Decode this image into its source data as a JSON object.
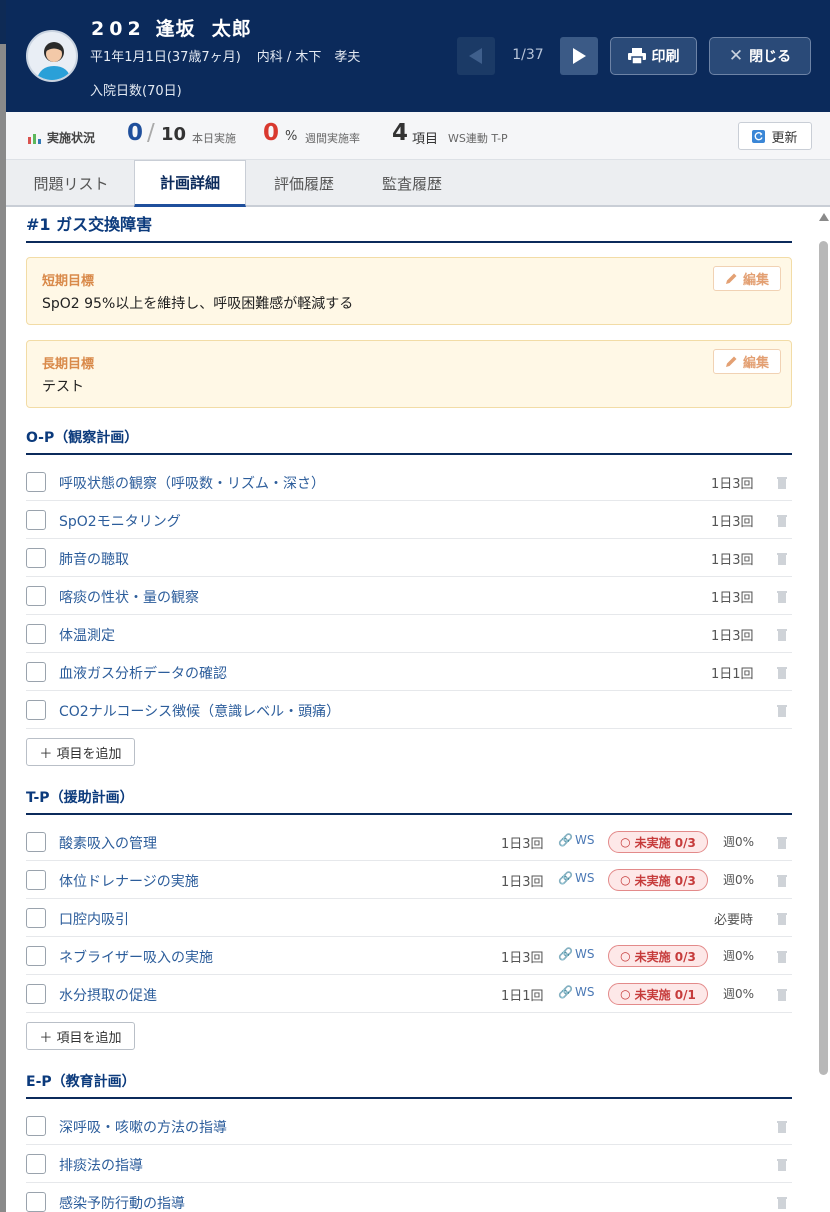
{
  "header": {
    "room": "202",
    "last_name": "逢坂",
    "first_name": "太郎",
    "birth": "平1年1月1日(37歳7ヶ月)",
    "dept_doctor": "内科 / 木下　孝夫",
    "admission_days": "入院日数(70日)",
    "pager": "1/37",
    "print_label": "印刷",
    "close_label": "閉じる"
  },
  "status": {
    "label": "実施状況",
    "done": "0",
    "slash": "/",
    "total": "10",
    "today_label": "本日実施",
    "rate": "0",
    "rate_unit": "%",
    "rate_label": "週間実施率",
    "items": "4",
    "items_unit": "項目",
    "items_label": "WS連動 T-P",
    "refresh_label": "更新"
  },
  "tabs": [
    "問題リスト",
    "計画詳細",
    "評価履歴",
    "監査履歴"
  ],
  "problem": {
    "title": "#1 ガス交換障害",
    "short_goal": {
      "label": "短期目標",
      "text": "SpO2 95%以上を維持し、呼吸困難感が軽減する",
      "edit": "編集"
    },
    "long_goal": {
      "label": "長期目標",
      "text": "テスト",
      "edit": "編集"
    },
    "add_label": "＋ 項目を追加",
    "sections": {
      "op": {
        "title": "O-P（観察計画）",
        "items": [
          {
            "name": "呼吸状態の観察（呼吸数・リズム・深さ）",
            "freq": "1日3回"
          },
          {
            "name": "SpO2モニタリング",
            "freq": "1日3回"
          },
          {
            "name": "肺音の聴取",
            "freq": "1日3回"
          },
          {
            "name": "喀痰の性状・量の観察",
            "freq": "1日3回"
          },
          {
            "name": "体温測定",
            "freq": "1日3回"
          },
          {
            "name": "血液ガス分析データの確認",
            "freq": "1日1回"
          },
          {
            "name": "CO2ナルコーシス徴候（意識レベル・頭痛）",
            "freq": ""
          }
        ]
      },
      "tp": {
        "title": "T-P（援助計画）",
        "ws_label": "WS",
        "items": [
          {
            "name": "酸素吸入の管理",
            "freq": "1日3回",
            "ws": true,
            "badge": "未実施 0/3",
            "week": "週0%"
          },
          {
            "name": "体位ドレナージの実施",
            "freq": "1日3回",
            "ws": true,
            "badge": "未実施 0/3",
            "week": "週0%"
          },
          {
            "name": "口腔内吸引",
            "freq": "必要時",
            "ws": false,
            "badge": "",
            "week": ""
          },
          {
            "name": "ネブライザー吸入の実施",
            "freq": "1日3回",
            "ws": true,
            "badge": "未実施 0/3",
            "week": "週0%"
          },
          {
            "name": "水分摂取の促進",
            "freq": "1日1回",
            "ws": true,
            "badge": "未実施 0/1",
            "week": "週0%"
          }
        ]
      },
      "ep": {
        "title": "E-P（教育計画）",
        "items": [
          {
            "name": "深呼吸・咳嗽の方法の指導",
            "freq": ""
          },
          {
            "name": "排痰法の指導",
            "freq": ""
          },
          {
            "name": "感染予防行動の指導",
            "freq": ""
          }
        ]
      }
    }
  },
  "colors": {
    "header_bg": "#0b2a5b",
    "accent": "#0b3a7c",
    "link": "#2c5d9b",
    "goal_bg": "#fff8e6",
    "badge_red": "#c63b3b"
  },
  "icons": {
    "avatar": "user-avatar-icon",
    "prev": "triangle-left-icon",
    "next": "triangle-right-icon",
    "print": "printer-icon",
    "close": "x-icon",
    "chart": "bar-chart-icon",
    "refresh": "refresh-icon",
    "edit": "pencil-icon",
    "trash": "trash-icon",
    "link": "link-icon"
  }
}
